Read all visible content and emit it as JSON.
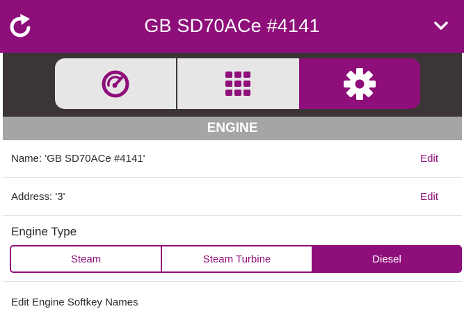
{
  "header": {
    "title": "GB SD70ACe #4141",
    "refresh_icon": "refresh-icon",
    "dropdown_icon": "chevron-down-icon"
  },
  "tabs": [
    {
      "icon": "speedometer-icon",
      "active": false
    },
    {
      "icon": "keypad-grid-icon",
      "active": false
    },
    {
      "icon": "gear-icon",
      "active": true
    }
  ],
  "section": {
    "title": "ENGINE"
  },
  "rows": {
    "name": {
      "label": "Name: 'GB SD70ACe #4141'",
      "action": "Edit"
    },
    "address": {
      "label": "Address: '3'",
      "action": "Edit"
    }
  },
  "engine_type": {
    "label": "Engine Type",
    "options": [
      "Steam",
      "Steam Turbine",
      "Diesel"
    ],
    "selected": "Diesel"
  },
  "softkeys": {
    "label": "Edit Engine Softkey Names"
  },
  "colors": {
    "accent": "#8e0e7a",
    "tab_bar": "#3b3537",
    "section_header": "#a5a5a5",
    "inactive_tab": "#e6e6e6"
  }
}
